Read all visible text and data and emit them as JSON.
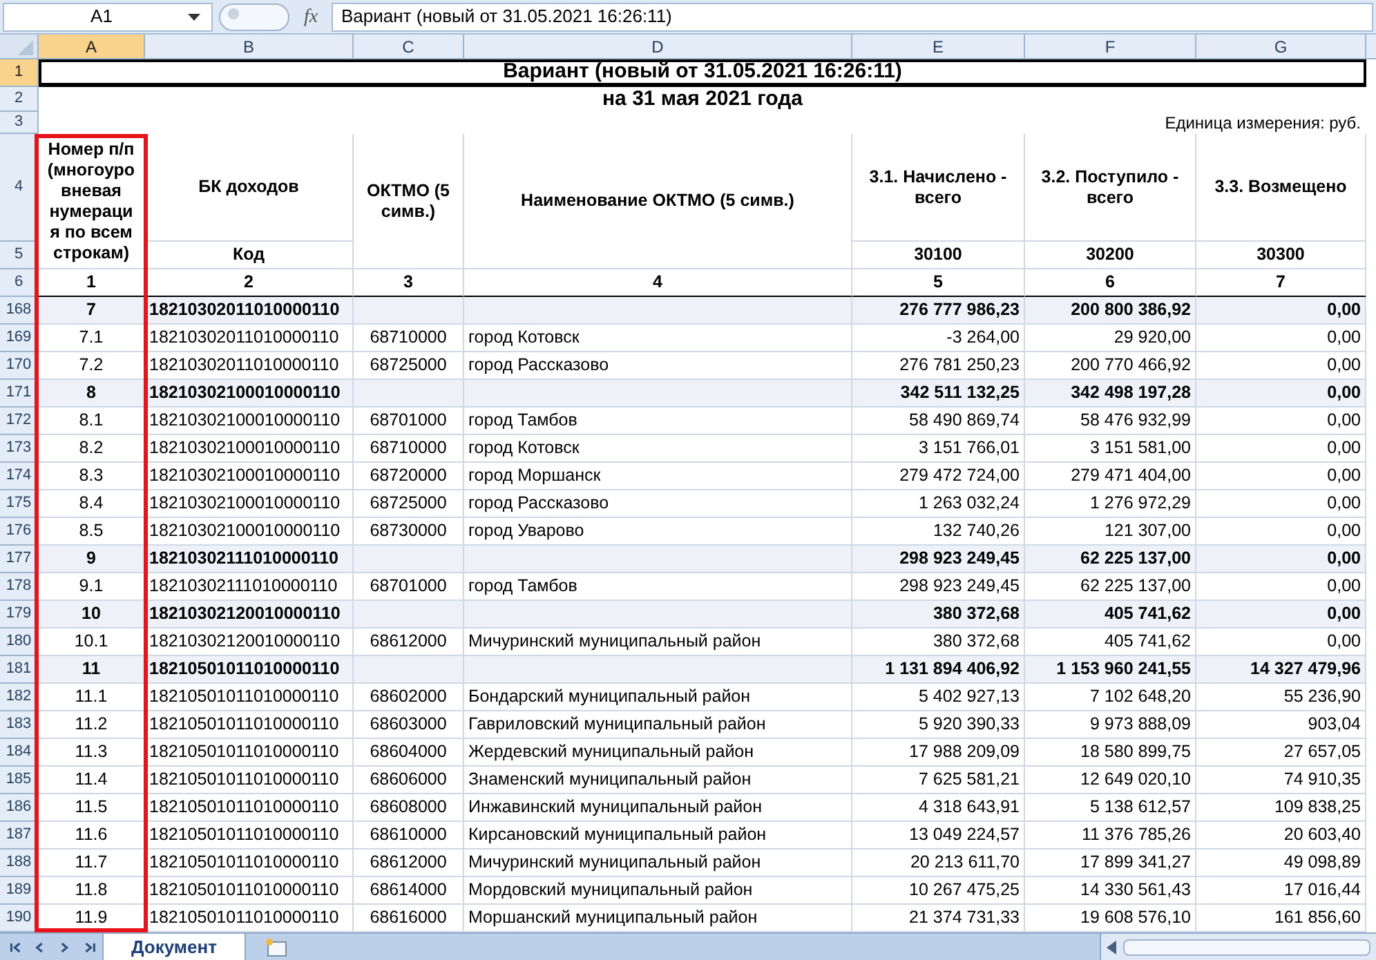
{
  "name_box": "A1",
  "function_label": "fx",
  "formula": "Вариант (новый от 31.05.2021 16:26:11)",
  "columns": [
    {
      "label": "A",
      "selected": true
    },
    {
      "label": "B",
      "selected": false
    },
    {
      "label": "C",
      "selected": false
    },
    {
      "label": "D",
      "selected": false
    },
    {
      "label": "E",
      "selected": false
    },
    {
      "label": "F",
      "selected": false
    },
    {
      "label": "G",
      "selected": false
    }
  ],
  "top_rows": [
    {
      "number": "1",
      "selected": true
    },
    {
      "number": "2",
      "selected": false
    },
    {
      "number": "3",
      "selected": false
    },
    {
      "number": "4",
      "selected": false
    },
    {
      "number": "5",
      "selected": false
    },
    {
      "number": "6",
      "selected": false
    }
  ],
  "title": "Вариант (новый от 31.05.2021 16:26:11)",
  "subtitle": "на 31 мая 2021 года",
  "unit_note": "Единица измерения: руб.",
  "header": {
    "num": "Номер п/п (многоуровневая нумерация по всем строкам)",
    "bk": "БК доходов",
    "bk_sub": "Код",
    "oktmo": "ОКТМО (5 симв.)",
    "name": "Наименование ОКТМО (5 симв.)",
    "accrued": "3.1. Начислено - всего",
    "accrued_code": "30100",
    "received": "3.2. Поступило - всего",
    "received_code": "30200",
    "refunded": "3.3. Возмещено",
    "refunded_code": "30300",
    "indexes": [
      "1",
      "2",
      "3",
      "4",
      "5",
      "6",
      "7"
    ]
  },
  "rows": [
    {
      "row_number": "168",
      "selected": false,
      "kind": "group",
      "num": "7",
      "code": "18210302011010000110",
      "accrued": "276 777 986,23",
      "received": "200 800 386,92",
      "refunded": "0,00"
    },
    {
      "row_number": "169",
      "selected": false,
      "kind": "item",
      "num": "7.1",
      "code": "18210302011010000110",
      "oktmo": "68710000",
      "name": "город Котовск",
      "accrued": "-3 264,00",
      "received": "29 920,00",
      "refunded": "0,00"
    },
    {
      "row_number": "170",
      "selected": false,
      "kind": "item",
      "num": "7.2",
      "code": "18210302011010000110",
      "oktmo": "68725000",
      "name": "город Рассказово",
      "accrued": "276 781 250,23",
      "received": "200 770 466,92",
      "refunded": "0,00"
    },
    {
      "row_number": "171",
      "selected": false,
      "kind": "group",
      "num": "8",
      "code": "18210302100010000110",
      "accrued": "342 511 132,25",
      "received": "342 498 197,28",
      "refunded": "0,00"
    },
    {
      "row_number": "172",
      "selected": false,
      "kind": "item",
      "num": "8.1",
      "code": "18210302100010000110",
      "oktmo": "68701000",
      "name": "город Тамбов",
      "accrued": "58 490 869,74",
      "received": "58 476 932,99",
      "refunded": "0,00"
    },
    {
      "row_number": "173",
      "selected": false,
      "kind": "item",
      "num": "8.2",
      "code": "18210302100010000110",
      "oktmo": "68710000",
      "name": "город Котовск",
      "accrued": "3 151 766,01",
      "received": "3 151 581,00",
      "refunded": "0,00"
    },
    {
      "row_number": "174",
      "selected": false,
      "kind": "item",
      "num": "8.3",
      "code": "18210302100010000110",
      "oktmo": "68720000",
      "name": "город Моршанск",
      "accrued": "279 472 724,00",
      "received": "279 471 404,00",
      "refunded": "0,00"
    },
    {
      "row_number": "175",
      "selected": false,
      "kind": "item",
      "num": "8.4",
      "code": "18210302100010000110",
      "oktmo": "68725000",
      "name": "город Рассказово",
      "accrued": "1 263 032,24",
      "received": "1 276 972,29",
      "refunded": "0,00"
    },
    {
      "row_number": "176",
      "selected": false,
      "kind": "item",
      "num": "8.5",
      "code": "18210302100010000110",
      "oktmo": "68730000",
      "name": "город Уварово",
      "accrued": "132 740,26",
      "received": "121 307,00",
      "refunded": "0,00"
    },
    {
      "row_number": "177",
      "selected": false,
      "kind": "group",
      "num": "9",
      "code": "18210302111010000110",
      "accrued": "298 923 249,45",
      "received": "62 225 137,00",
      "refunded": "0,00"
    },
    {
      "row_number": "178",
      "selected": false,
      "kind": "item",
      "num": "9.1",
      "code": "18210302111010000110",
      "oktmo": "68701000",
      "name": "город Тамбов",
      "accrued": "298 923 249,45",
      "received": "62 225 137,00",
      "refunded": "0,00"
    },
    {
      "row_number": "179",
      "selected": false,
      "kind": "group",
      "num": "10",
      "code": "18210302120010000110",
      "accrued": "380 372,68",
      "received": "405 741,62",
      "refunded": "0,00"
    },
    {
      "row_number": "180",
      "selected": false,
      "kind": "item",
      "num": "10.1",
      "code": "18210302120010000110",
      "oktmo": "68612000",
      "name": "Мичуринский муниципальный район",
      "accrued": "380 372,68",
      "received": "405 741,62",
      "refunded": "0,00"
    },
    {
      "row_number": "181",
      "selected": false,
      "kind": "group",
      "num": "11",
      "code": "18210501011010000110",
      "accrued": "1 131 894 406,92",
      "received": "1 153 960 241,55",
      "refunded": "14 327 479,96"
    },
    {
      "row_number": "182",
      "selected": false,
      "kind": "item",
      "num": "11.1",
      "code": "18210501011010000110",
      "oktmo": "68602000",
      "name": "Бондарский муниципальный район",
      "accrued": "5 402 927,13",
      "received": "7 102 648,20",
      "refunded": "55 236,90"
    },
    {
      "row_number": "183",
      "selected": false,
      "kind": "item",
      "num": "11.2",
      "code": "18210501011010000110",
      "oktmo": "68603000",
      "name": "Гавриловский муниципальный район",
      "accrued": "5 920 390,33",
      "received": "9 973 888,09",
      "refunded": "903,04"
    },
    {
      "row_number": "184",
      "selected": false,
      "kind": "item",
      "num": "11.3",
      "code": "18210501011010000110",
      "oktmo": "68604000",
      "name": "Жердевский муниципальный район",
      "accrued": "17 988 209,09",
      "received": "18 580 899,75",
      "refunded": "27 657,05"
    },
    {
      "row_number": "185",
      "selected": false,
      "kind": "item",
      "num": "11.4",
      "code": "18210501011010000110",
      "oktmo": "68606000",
      "name": "Знаменский муниципальный район",
      "accrued": "7 625 581,21",
      "received": "12 649 020,10",
      "refunded": "74 910,35"
    },
    {
      "row_number": "186",
      "selected": false,
      "kind": "item",
      "num": "11.5",
      "code": "18210501011010000110",
      "oktmo": "68608000",
      "name": "Инжавинский муниципальный район",
      "accrued": "4 318 643,91",
      "received": "5 138 612,57",
      "refunded": "109 838,25"
    },
    {
      "row_number": "187",
      "selected": false,
      "kind": "item",
      "num": "11.6",
      "code": "18210501011010000110",
      "oktmo": "68610000",
      "name": "Кирсановский муниципальный район",
      "accrued": "13 049 224,57",
      "received": "11 376 785,26",
      "refunded": "20 603,40"
    },
    {
      "row_number": "188",
      "selected": false,
      "kind": "item",
      "num": "11.7",
      "code": "18210501011010000110",
      "oktmo": "68612000",
      "name": "Мичуринский муниципальный район",
      "accrued": "20 213 611,70",
      "received": "17 899 341,27",
      "refunded": "49 098,89"
    },
    {
      "row_number": "189",
      "selected": false,
      "kind": "item",
      "num": "11.8",
      "code": "18210501011010000110",
      "oktmo": "68614000",
      "name": "Мордовский муниципальный район",
      "accrued": "10 267 475,25",
      "received": "14 330 561,43",
      "refunded": "17 016,44"
    },
    {
      "row_number": "190",
      "selected": false,
      "kind": "item",
      "num": "11.9",
      "code": "18210501011010000110",
      "oktmo": "68616000",
      "name": "Моршанский муниципальный район",
      "accrued": "21 374 731,33",
      "received": "19 608 576,10",
      "refunded": "161 856,60"
    }
  ],
  "sheet_tabs": [
    {
      "label": "Документ",
      "selected": true
    }
  ]
}
